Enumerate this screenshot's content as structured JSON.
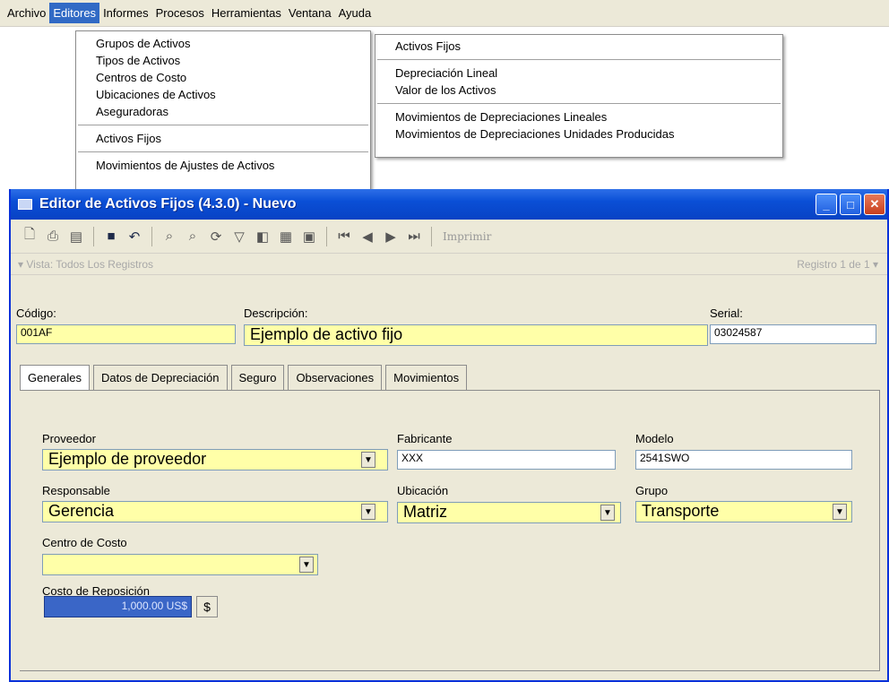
{
  "menubar": [
    "Archivo",
    "Editores",
    "Informes",
    "Procesos",
    "Herramientas",
    "Ventana",
    "Ayuda"
  ],
  "editores_menu": {
    "group1": [
      "Grupos de Activos",
      "Tipos de Activos",
      "Centros de Costo",
      "Ubicaciones de Activos",
      "Aseguradoras"
    ],
    "activos_fijos": "Activos Fijos",
    "movimientos_ajustes": "Movimientos de Ajustes de Activos"
  },
  "submenu": {
    "activos_fijos": "Activos Fijos",
    "group2": [
      "Depreciación Lineal",
      "Valor de los Activos"
    ],
    "group3": [
      "Movimientos de Depreciaciones Lineales",
      "Movimientos de Depreciaciones Unidades Producidas"
    ]
  },
  "window": {
    "title": "Editor de Activos Fijos (4.3.0) - Nuevo",
    "imprimir": "Imprimir"
  },
  "viewbar": {
    "vista": "Vista: Todos Los Registros",
    "registro": "Registro 1 de 1"
  },
  "form": {
    "codigo_label": "Código:",
    "codigo": "001AF",
    "descripcion_label": "Descripción:",
    "descripcion": "Ejemplo de activo fijo",
    "serial_label": "Serial:",
    "serial": "03024587"
  },
  "tabs": [
    "Generales",
    "Datos de Depreciación",
    "Seguro",
    "Observaciones",
    "Movimientos"
  ],
  "generales": {
    "proveedor_label": "Proveedor",
    "proveedor": "Ejemplo de proveedor",
    "fabricante_label": "Fabricante",
    "fabricante": "XXX",
    "modelo_label": "Modelo",
    "modelo": "2541SWO",
    "responsable_label": "Responsable",
    "responsable": "Gerencia",
    "ubicacion_label": "Ubicación",
    "ubicacion": "Matriz",
    "grupo_label": "Grupo",
    "grupo": "Transporte",
    "centro_label": "Centro de Costo",
    "centro": "",
    "costo_label": "Costo de Reposición",
    "costo": "1,000.00 US$",
    "costo_btn": "$"
  },
  "colors": {
    "title_bar": "#0a4fd6",
    "required_field": "#ffffa8",
    "menu_highlight": "#316ac5"
  }
}
